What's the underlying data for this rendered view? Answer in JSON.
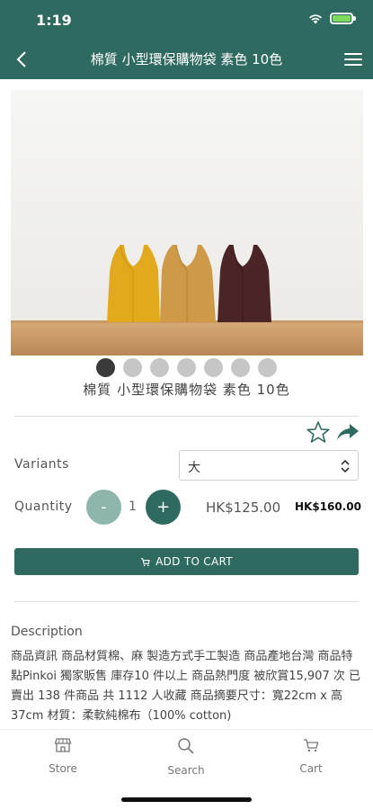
{
  "status_bar": {
    "time": "1:19"
  },
  "navbar": {
    "title": "棉質 小型環保購物袋 素色 10色"
  },
  "product": {
    "caption": "棉質 小型環保購物袋 素色 10色",
    "image_count": 7,
    "active_image": 1,
    "bag_colors": [
      "#e2a91c",
      "#cf9a47",
      "#4a2426"
    ]
  },
  "options": {
    "variants_label": "Variants",
    "variant_value": "大",
    "quantity_label": "Quantity",
    "quantity_value": "1",
    "minus_label": "-",
    "plus_label": "+",
    "price_sale": "HK$125.00",
    "price_original": "HK$160.00"
  },
  "add_to_cart": {
    "label": "ADD TO CART"
  },
  "description": {
    "title": "Description",
    "body": "商品資訊 商品材質棉、麻 製造方式手工製造 商品產地台灣 商品特點Pinkoi 獨家販售 庫存10 件以上 商品熱門度 被欣賞15,907 次 已賣出 138 件商品 共 1112 人收藏 商品摘要尺寸：寬22cm x 高37cm 材質：柔軟純棉布（100% cotton)"
  },
  "tabs": [
    {
      "label": "Store",
      "icon": "store-icon"
    },
    {
      "label": "Search",
      "icon": "search-icon"
    },
    {
      "label": "Cart",
      "icon": "cart-icon"
    }
  ],
  "colors": {
    "brand": "#2f6a60",
    "brand_light": "#8fb6ad"
  }
}
